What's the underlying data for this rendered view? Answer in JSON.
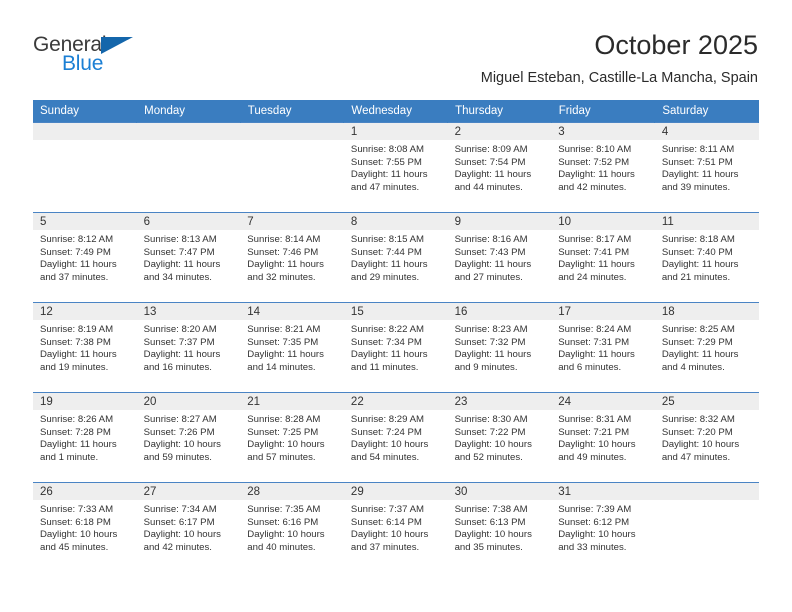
{
  "logo": {
    "line1": "General",
    "line2": "Blue",
    "triangle_color": "#1466ab",
    "blue_color": "#1b7fd4"
  },
  "header": {
    "title": "October 2025",
    "subtitle": "Miguel Esteban, Castille-La Mancha, Spain"
  },
  "theme": {
    "header_bg": "#3a7dc0",
    "daynum_bg": "#eeeeee",
    "row_divider": "#4a84c4"
  },
  "weekdays": [
    "Sunday",
    "Monday",
    "Tuesday",
    "Wednesday",
    "Thursday",
    "Friday",
    "Saturday"
  ],
  "labels": {
    "sunrise_prefix": "Sunrise:",
    "sunset_prefix": "Sunset:",
    "daylight_prefix": "Daylight:"
  },
  "weeks": [
    [
      {
        "day": "",
        "blank": true,
        "sunrise": "",
        "sunset": "",
        "daylight_line1": "",
        "daylight_line2": ""
      },
      {
        "day": "",
        "blank": true,
        "sunrise": "",
        "sunset": "",
        "daylight_line1": "",
        "daylight_line2": ""
      },
      {
        "day": "",
        "blank": true,
        "sunrise": "",
        "sunset": "",
        "daylight_line1": "",
        "daylight_line2": ""
      },
      {
        "day": "1",
        "blank": false,
        "sunrise": "Sunrise: 8:08 AM",
        "sunset": "Sunset: 7:55 PM",
        "daylight_line1": "Daylight: 11 hours",
        "daylight_line2": "and 47 minutes."
      },
      {
        "day": "2",
        "blank": false,
        "sunrise": "Sunrise: 8:09 AM",
        "sunset": "Sunset: 7:54 PM",
        "daylight_line1": "Daylight: 11 hours",
        "daylight_line2": "and 44 minutes."
      },
      {
        "day": "3",
        "blank": false,
        "sunrise": "Sunrise: 8:10 AM",
        "sunset": "Sunset: 7:52 PM",
        "daylight_line1": "Daylight: 11 hours",
        "daylight_line2": "and 42 minutes."
      },
      {
        "day": "4",
        "blank": false,
        "sunrise": "Sunrise: 8:11 AM",
        "sunset": "Sunset: 7:51 PM",
        "daylight_line1": "Daylight: 11 hours",
        "daylight_line2": "and 39 minutes."
      }
    ],
    [
      {
        "day": "5",
        "blank": false,
        "sunrise": "Sunrise: 8:12 AM",
        "sunset": "Sunset: 7:49 PM",
        "daylight_line1": "Daylight: 11 hours",
        "daylight_line2": "and 37 minutes."
      },
      {
        "day": "6",
        "blank": false,
        "sunrise": "Sunrise: 8:13 AM",
        "sunset": "Sunset: 7:47 PM",
        "daylight_line1": "Daylight: 11 hours",
        "daylight_line2": "and 34 minutes."
      },
      {
        "day": "7",
        "blank": false,
        "sunrise": "Sunrise: 8:14 AM",
        "sunset": "Sunset: 7:46 PM",
        "daylight_line1": "Daylight: 11 hours",
        "daylight_line2": "and 32 minutes."
      },
      {
        "day": "8",
        "blank": false,
        "sunrise": "Sunrise: 8:15 AM",
        "sunset": "Sunset: 7:44 PM",
        "daylight_line1": "Daylight: 11 hours",
        "daylight_line2": "and 29 minutes."
      },
      {
        "day": "9",
        "blank": false,
        "sunrise": "Sunrise: 8:16 AM",
        "sunset": "Sunset: 7:43 PM",
        "daylight_line1": "Daylight: 11 hours",
        "daylight_line2": "and 27 minutes."
      },
      {
        "day": "10",
        "blank": false,
        "sunrise": "Sunrise: 8:17 AM",
        "sunset": "Sunset: 7:41 PM",
        "daylight_line1": "Daylight: 11 hours",
        "daylight_line2": "and 24 minutes."
      },
      {
        "day": "11",
        "blank": false,
        "sunrise": "Sunrise: 8:18 AM",
        "sunset": "Sunset: 7:40 PM",
        "daylight_line1": "Daylight: 11 hours",
        "daylight_line2": "and 21 minutes."
      }
    ],
    [
      {
        "day": "12",
        "blank": false,
        "sunrise": "Sunrise: 8:19 AM",
        "sunset": "Sunset: 7:38 PM",
        "daylight_line1": "Daylight: 11 hours",
        "daylight_line2": "and 19 minutes."
      },
      {
        "day": "13",
        "blank": false,
        "sunrise": "Sunrise: 8:20 AM",
        "sunset": "Sunset: 7:37 PM",
        "daylight_line1": "Daylight: 11 hours",
        "daylight_line2": "and 16 minutes."
      },
      {
        "day": "14",
        "blank": false,
        "sunrise": "Sunrise: 8:21 AM",
        "sunset": "Sunset: 7:35 PM",
        "daylight_line1": "Daylight: 11 hours",
        "daylight_line2": "and 14 minutes."
      },
      {
        "day": "15",
        "blank": false,
        "sunrise": "Sunrise: 8:22 AM",
        "sunset": "Sunset: 7:34 PM",
        "daylight_line1": "Daylight: 11 hours",
        "daylight_line2": "and 11 minutes."
      },
      {
        "day": "16",
        "blank": false,
        "sunrise": "Sunrise: 8:23 AM",
        "sunset": "Sunset: 7:32 PM",
        "daylight_line1": "Daylight: 11 hours",
        "daylight_line2": "and 9 minutes."
      },
      {
        "day": "17",
        "blank": false,
        "sunrise": "Sunrise: 8:24 AM",
        "sunset": "Sunset: 7:31 PM",
        "daylight_line1": "Daylight: 11 hours",
        "daylight_line2": "and 6 minutes."
      },
      {
        "day": "18",
        "blank": false,
        "sunrise": "Sunrise: 8:25 AM",
        "sunset": "Sunset: 7:29 PM",
        "daylight_line1": "Daylight: 11 hours",
        "daylight_line2": "and 4 minutes."
      }
    ],
    [
      {
        "day": "19",
        "blank": false,
        "sunrise": "Sunrise: 8:26 AM",
        "sunset": "Sunset: 7:28 PM",
        "daylight_line1": "Daylight: 11 hours",
        "daylight_line2": "and 1 minute."
      },
      {
        "day": "20",
        "blank": false,
        "sunrise": "Sunrise: 8:27 AM",
        "sunset": "Sunset: 7:26 PM",
        "daylight_line1": "Daylight: 10 hours",
        "daylight_line2": "and 59 minutes."
      },
      {
        "day": "21",
        "blank": false,
        "sunrise": "Sunrise: 8:28 AM",
        "sunset": "Sunset: 7:25 PM",
        "daylight_line1": "Daylight: 10 hours",
        "daylight_line2": "and 57 minutes."
      },
      {
        "day": "22",
        "blank": false,
        "sunrise": "Sunrise: 8:29 AM",
        "sunset": "Sunset: 7:24 PM",
        "daylight_line1": "Daylight: 10 hours",
        "daylight_line2": "and 54 minutes."
      },
      {
        "day": "23",
        "blank": false,
        "sunrise": "Sunrise: 8:30 AM",
        "sunset": "Sunset: 7:22 PM",
        "daylight_line1": "Daylight: 10 hours",
        "daylight_line2": "and 52 minutes."
      },
      {
        "day": "24",
        "blank": false,
        "sunrise": "Sunrise: 8:31 AM",
        "sunset": "Sunset: 7:21 PM",
        "daylight_line1": "Daylight: 10 hours",
        "daylight_line2": "and 49 minutes."
      },
      {
        "day": "25",
        "blank": false,
        "sunrise": "Sunrise: 8:32 AM",
        "sunset": "Sunset: 7:20 PM",
        "daylight_line1": "Daylight: 10 hours",
        "daylight_line2": "and 47 minutes."
      }
    ],
    [
      {
        "day": "26",
        "blank": false,
        "sunrise": "Sunrise: 7:33 AM",
        "sunset": "Sunset: 6:18 PM",
        "daylight_line1": "Daylight: 10 hours",
        "daylight_line2": "and 45 minutes."
      },
      {
        "day": "27",
        "blank": false,
        "sunrise": "Sunrise: 7:34 AM",
        "sunset": "Sunset: 6:17 PM",
        "daylight_line1": "Daylight: 10 hours",
        "daylight_line2": "and 42 minutes."
      },
      {
        "day": "28",
        "blank": false,
        "sunrise": "Sunrise: 7:35 AM",
        "sunset": "Sunset: 6:16 PM",
        "daylight_line1": "Daylight: 10 hours",
        "daylight_line2": "and 40 minutes."
      },
      {
        "day": "29",
        "blank": false,
        "sunrise": "Sunrise: 7:37 AM",
        "sunset": "Sunset: 6:14 PM",
        "daylight_line1": "Daylight: 10 hours",
        "daylight_line2": "and 37 minutes."
      },
      {
        "day": "30",
        "blank": false,
        "sunrise": "Sunrise: 7:38 AM",
        "sunset": "Sunset: 6:13 PM",
        "daylight_line1": "Daylight: 10 hours",
        "daylight_line2": "and 35 minutes."
      },
      {
        "day": "31",
        "blank": false,
        "sunrise": "Sunrise: 7:39 AM",
        "sunset": "Sunset: 6:12 PM",
        "daylight_line1": "Daylight: 10 hours",
        "daylight_line2": "and 33 minutes."
      },
      {
        "day": "",
        "blank": true,
        "sunrise": "",
        "sunset": "",
        "daylight_line1": "",
        "daylight_line2": ""
      }
    ]
  ]
}
